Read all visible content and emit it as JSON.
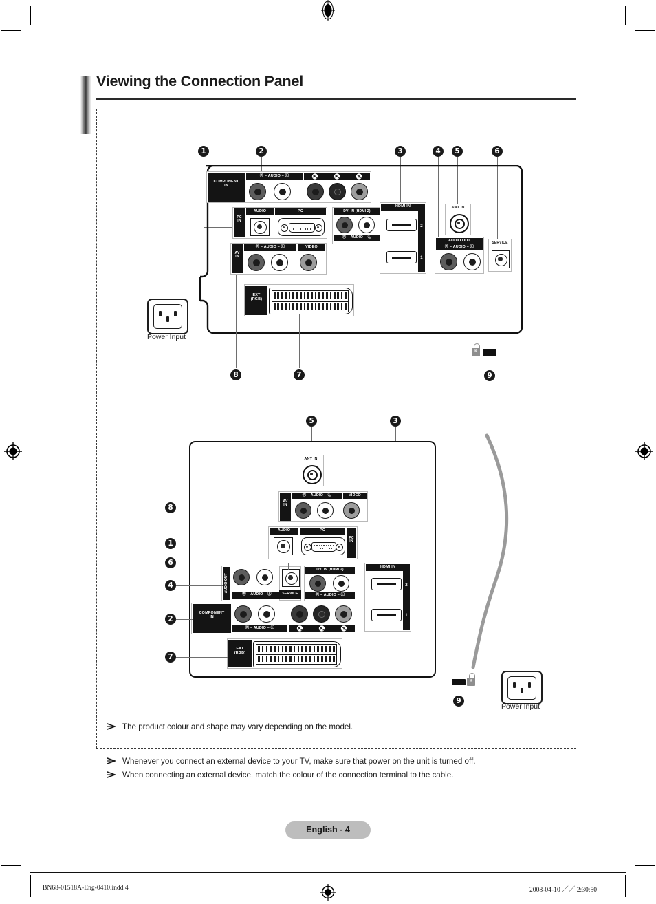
{
  "page": {
    "title": "Viewing the Connection Panel",
    "badge": "English - 4",
    "footer_left": "BN68-01518A-Eng-0410.indd   4",
    "footer_right": "2008-04-10   ／／ 2:30:50"
  },
  "labels": {
    "power_input": "Power Input",
    "component_in": "COMPONENT\nIN",
    "component_in_l1": "COMPONENT",
    "component_in_l2": "IN",
    "audio": "AUDIO",
    "audio_dashes": "Ⓡ – AUDIO – Ⓛ",
    "audio_out": "AUDIO OUT",
    "pc": "PC",
    "pc_in_l1": "PC",
    "pc_in_l2": "IN",
    "av_in_l1": "AV",
    "av_in_l2": "IN",
    "video": "VIDEO",
    "hdmi_in": "HDMI IN",
    "hdmi_2": "2",
    "hdmi_1": "1",
    "dvi_in": "DVI IN (HDMI 2)",
    "ant_in": "ANT IN",
    "service": "SERVICE",
    "ext_rgb_l1": "EXT",
    "ext_rgb_l2": "(RGB)",
    "pb": "P",
    "pb_sub": "B",
    "pr": "P",
    "pr_sub": "R",
    "y": "Y",
    "k_lock": "K"
  },
  "callouts": {
    "c1": "1",
    "c2": "2",
    "c3": "3",
    "c4": "4",
    "c5": "5",
    "c6": "6",
    "c7": "7",
    "c8": "8",
    "c9": "9"
  },
  "notes": {
    "inside": "The product colour and shape may vary depending on the model.",
    "outside_1": "Whenever you connect an external device to your TV, make sure that power on the unit is turned off.",
    "outside_2": "When connecting an external device, match the colour of the connection terminal to the cable."
  },
  "colors": {
    "ink": "#1a1a1a",
    "badge_bg": "#bdbdbd",
    "cable_grey": "#9a9a9a",
    "jack_red": "#5d5d5d",
    "jack_white": "#ffffff",
    "jack_green": "#3a3a3a",
    "jack_yellow": "#9d9d9d"
  }
}
